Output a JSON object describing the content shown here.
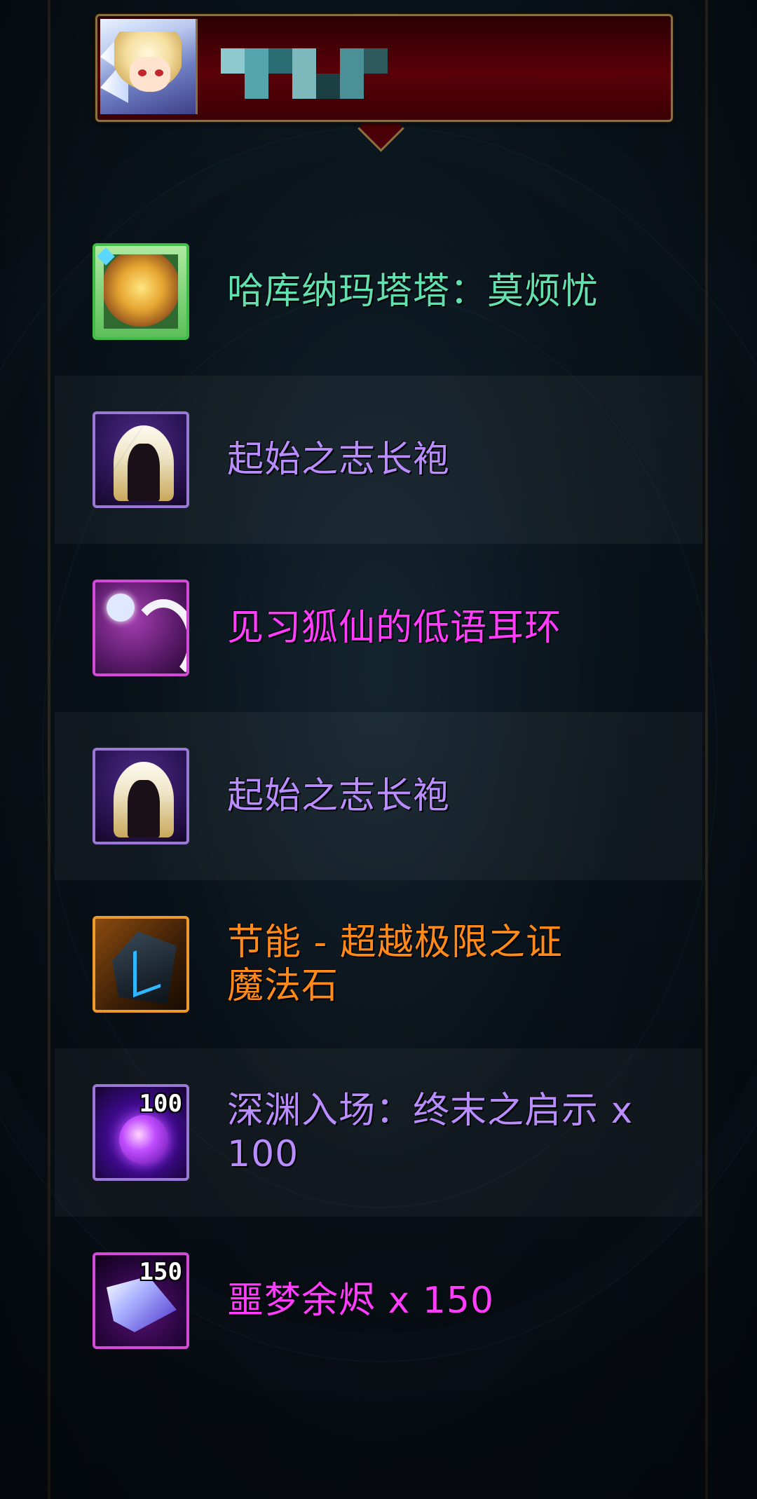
{
  "header": {
    "player_name": ""
  },
  "rewards": [
    {
      "name": "哈库纳玛塔塔：莫烦忧",
      "color": "#62e0b0",
      "icon": "lion-card-icon",
      "count": ""
    },
    {
      "name": "起始之志长袍",
      "color": "#b98cff",
      "icon": "robe-icon",
      "count": ""
    },
    {
      "name": "见习狐仙的低语耳环",
      "color": "#ff3cff",
      "icon": "fox-earring-icon",
      "count": ""
    },
    {
      "name": "起始之志长袍",
      "color": "#b98cff",
      "icon": "robe-icon",
      "count": ""
    },
    {
      "name": "节能 - 超越极限之证\n魔法石",
      "color": "#ff8a1a",
      "icon": "magic-stone-icon",
      "count": ""
    },
    {
      "name": "深渊入场：终末之启示 x 100",
      "color": "#b98cff",
      "icon": "abyss-orb-icon",
      "count": "100"
    },
    {
      "name": "噩梦余烬 x 150",
      "color": "#ff3cff",
      "icon": "nightmare-ember-icon",
      "count": "150"
    }
  ]
}
